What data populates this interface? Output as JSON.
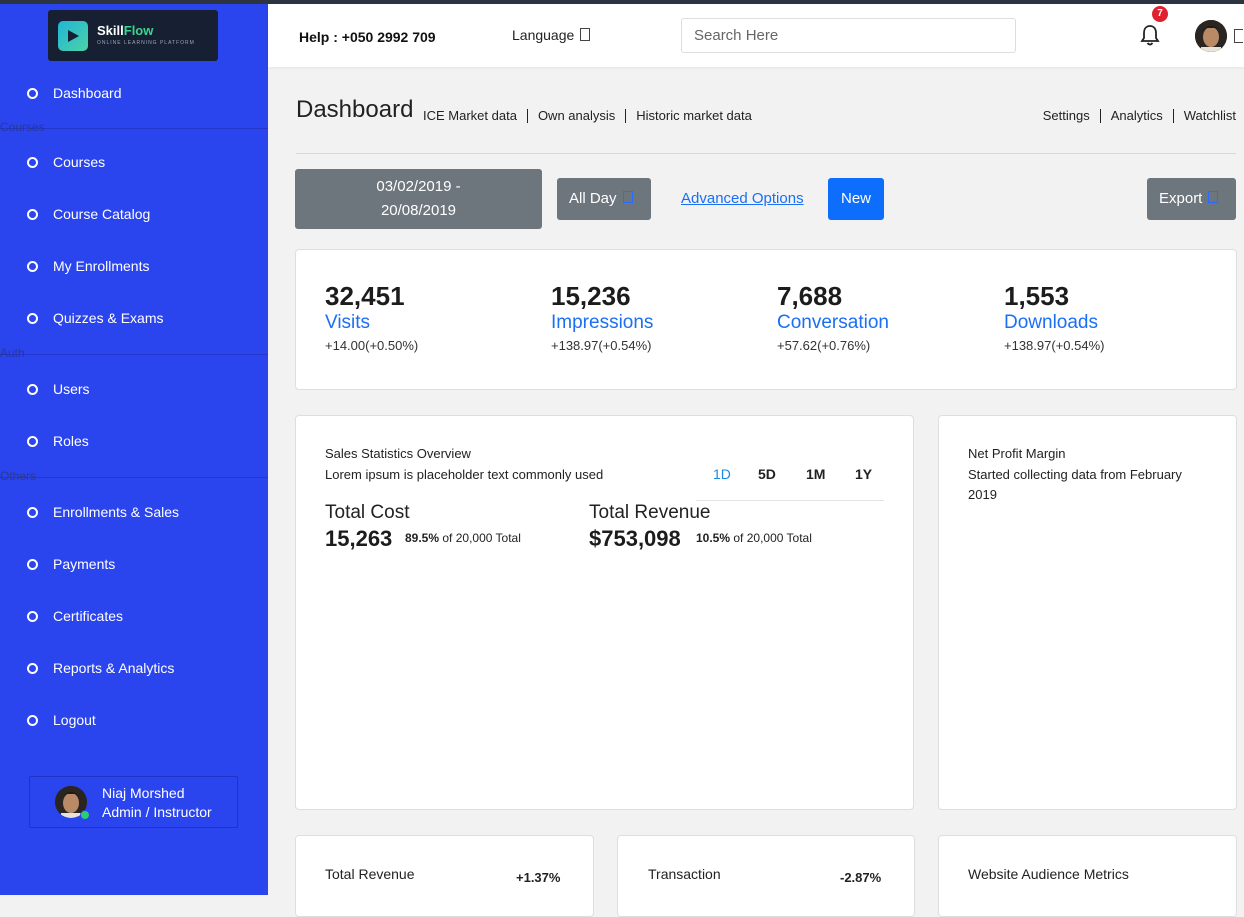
{
  "brand": {
    "name_main": "Skill",
    "name_accent": "Flow",
    "tagline": "ONLINE LEARNING PLATFORM"
  },
  "sidebar": {
    "items": [
      {
        "label": "Dashboard"
      },
      {
        "label": "Courses"
      },
      {
        "label": "Course Catalog"
      },
      {
        "label": "My Enrollments"
      },
      {
        "label": "Quizzes & Exams"
      },
      {
        "label": "Users"
      },
      {
        "label": "Roles"
      },
      {
        "label": "Enrollments & Sales"
      },
      {
        "label": "Payments"
      },
      {
        "label": "Certificates"
      },
      {
        "label": "Reports & Analytics"
      },
      {
        "label": "Logout"
      }
    ],
    "sections": [
      "Courses",
      "Auth",
      "Others"
    ],
    "user": {
      "name": "Niaj Morshed",
      "role": "Admin / Instructor"
    }
  },
  "header": {
    "help": "Help : +050 2992 709",
    "language": "Language",
    "search_placeholder": "Search Here",
    "notifications": "7"
  },
  "page": {
    "title": "Dashboard",
    "left_links": [
      "ICE Market data",
      "Own analysis",
      "Historic market data"
    ],
    "right_links": [
      "Settings",
      "Analytics",
      "Watchlist"
    ]
  },
  "toolbar": {
    "date_line1": "03/02/2019 -",
    "date_line2": "20/08/2019",
    "all_day": "All Day",
    "advanced": "Advanced Options",
    "new": "New",
    "export": "Export"
  },
  "stats": [
    {
      "value": "32,451",
      "label": "Visits",
      "change": "+14.00(+0.50%)"
    },
    {
      "value": "15,236",
      "label": "Impressions",
      "change": "+138.97(+0.54%)"
    },
    {
      "value": "7,688",
      "label": "Conversation",
      "change": "+57.62(+0.76%)"
    },
    {
      "value": "1,553",
      "label": "Downloads",
      "change": "+138.97(+0.54%)"
    }
  ],
  "sales": {
    "title": "Sales Statistics Overview",
    "subtitle": "Lorem ipsum is placeholder text commonly used",
    "tabs": [
      "1D",
      "5D",
      "1M",
      "1Y"
    ],
    "cost": {
      "heading": "Total Cost",
      "value": "15,263",
      "pct": "89.5%",
      "suffix": "of 20,000 Total"
    },
    "revenue": {
      "heading": "Total Revenue",
      "value": "$753,098",
      "pct": "10.5%",
      "suffix": "of 20,000 Total"
    }
  },
  "profit": {
    "title": "Net Profit Margin",
    "subtitle": "Started collecting data from February 2019"
  },
  "bottom": [
    {
      "title": "Total Revenue",
      "change": "+1.37%"
    },
    {
      "title": "Transaction",
      "change": "-2.87%"
    },
    {
      "title": "Website Audience Metrics"
    }
  ]
}
